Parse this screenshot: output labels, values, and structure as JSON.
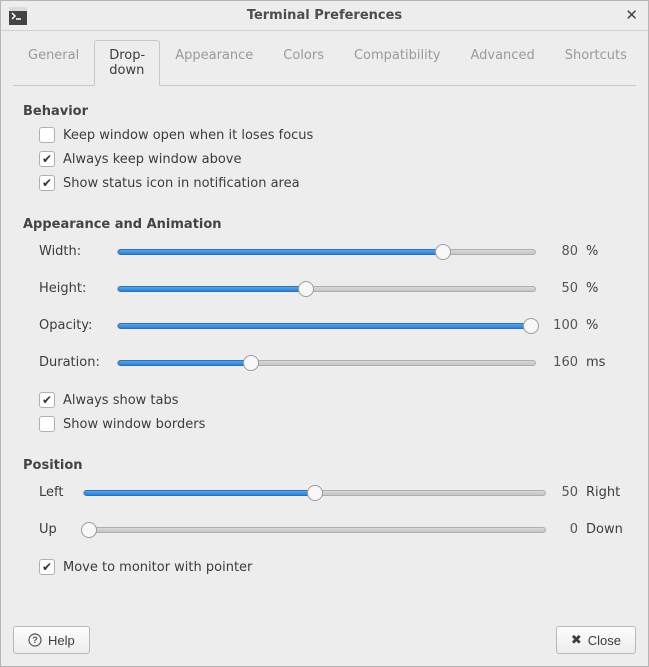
{
  "window": {
    "title": "Terminal Preferences"
  },
  "tabs": {
    "general": "General",
    "dropdown": "Drop-down",
    "appearance": "Appearance",
    "colors": "Colors",
    "compatibility": "Compatibility",
    "advanced": "Advanced",
    "shortcuts": "Shortcuts",
    "active": "dropdown"
  },
  "behavior": {
    "header": "Behavior",
    "keep_open_label": "Keep window open when it loses focus",
    "keep_open_checked": false,
    "always_above_label": "Always keep window above",
    "always_above_checked": true,
    "status_icon_label": "Show status icon in notification area",
    "status_icon_checked": true
  },
  "appearance_anim": {
    "header": "Appearance and Animation",
    "width_label": "Width:",
    "width_value": 80,
    "width_unit": "%",
    "height_label": "Height:",
    "height_value": 50,
    "height_unit": "%",
    "opacity_label": "Opacity:",
    "opacity_value": 100,
    "opacity_unit": "%",
    "duration_label": "Duration:",
    "duration_value": 160,
    "duration_unit": "ms",
    "always_tabs_label": "Always show tabs",
    "always_tabs_checked": true,
    "borders_label": "Show window borders",
    "borders_checked": false
  },
  "position": {
    "header": "Position",
    "horiz_left_label": "Left",
    "horiz_right_label": "Right",
    "horiz_value": 50,
    "vert_up_label": "Up",
    "vert_down_label": "Down",
    "vert_value": 0,
    "move_monitor_label": "Move to monitor with pointer",
    "move_monitor_checked": true
  },
  "footer": {
    "help": "Help",
    "close": "Close"
  }
}
